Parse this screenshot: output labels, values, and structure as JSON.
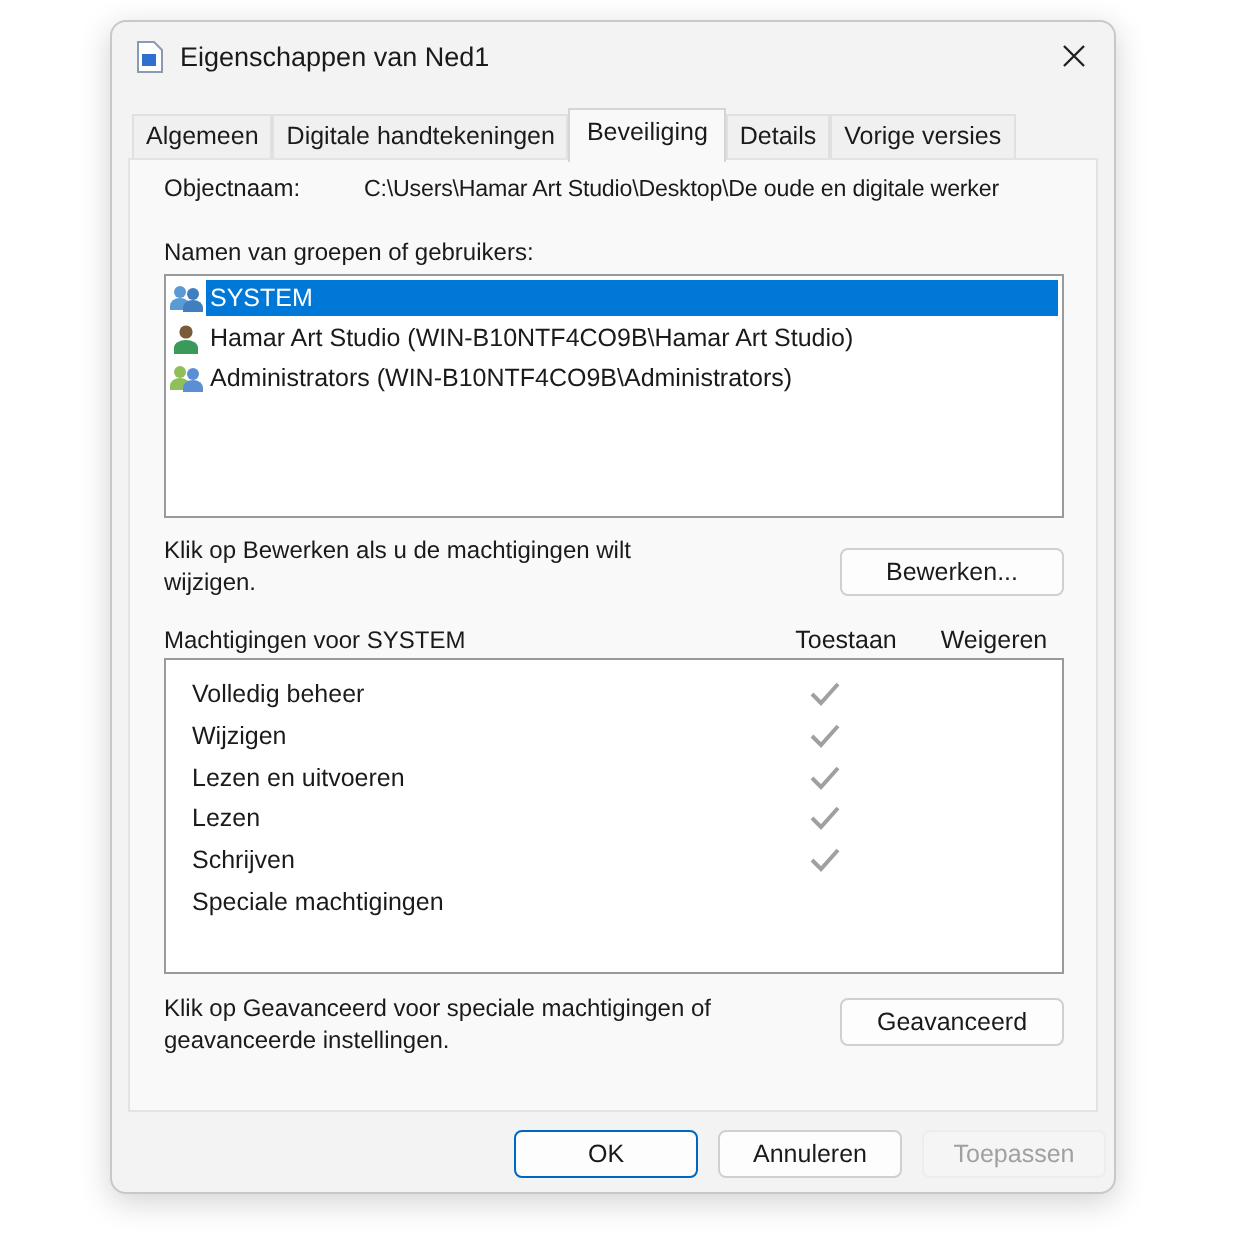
{
  "window": {
    "title": "Eigenschappen van Ned1"
  },
  "tabs": [
    {
      "label": "Algemeen",
      "selected": false
    },
    {
      "label": "Digitale handtekeningen",
      "selected": false
    },
    {
      "label": "Beveiliging",
      "selected": true
    },
    {
      "label": "Details",
      "selected": false
    },
    {
      "label": "Vorige versies",
      "selected": false
    }
  ],
  "object": {
    "label": "Objectnaam:",
    "value": "C:\\Users\\Hamar Art Studio\\Desktop\\De oude en digitale werker"
  },
  "users": {
    "label": "Namen van groepen of gebruikers:",
    "items": [
      {
        "name": "SYSTEM",
        "kind": "group",
        "selected": true
      },
      {
        "name": "Hamar Art Studio (WIN-B10NTF4CO9B\\Hamar Art Studio)",
        "kind": "user",
        "selected": false
      },
      {
        "name": "Administrators (WIN-B10NTF4CO9B\\Administrators)",
        "kind": "admins",
        "selected": false
      }
    ]
  },
  "edit": {
    "hint": "Klik op Bewerken als u de machtigingen wilt wijzigen.",
    "button": "Bewerken..."
  },
  "permissions": {
    "title": "Machtigingen voor SYSTEM",
    "allow_header": "Toestaan",
    "deny_header": "Weigeren",
    "rows": [
      {
        "name": "Volledig beheer",
        "allow": true,
        "deny": false
      },
      {
        "name": "Wijzigen",
        "allow": true,
        "deny": false
      },
      {
        "name": "Lezen en uitvoeren",
        "allow": true,
        "deny": false
      },
      {
        "name": "Lezen",
        "allow": true,
        "deny": false
      },
      {
        "name": "Schrijven",
        "allow": true,
        "deny": false
      },
      {
        "name": "Speciale machtigingen",
        "allow": false,
        "deny": false
      }
    ]
  },
  "advanced": {
    "hint": "Klik op Geavanceerd voor speciale machtigingen of geavanceerde instellingen.",
    "button": "Geavanceerd"
  },
  "buttons": [
    {
      "label": "OK",
      "kind": "default",
      "disabled": false
    },
    {
      "label": "Annuleren",
      "kind": "normal",
      "disabled": false
    },
    {
      "label": "Toepassen",
      "kind": "normal",
      "disabled": true
    }
  ]
}
